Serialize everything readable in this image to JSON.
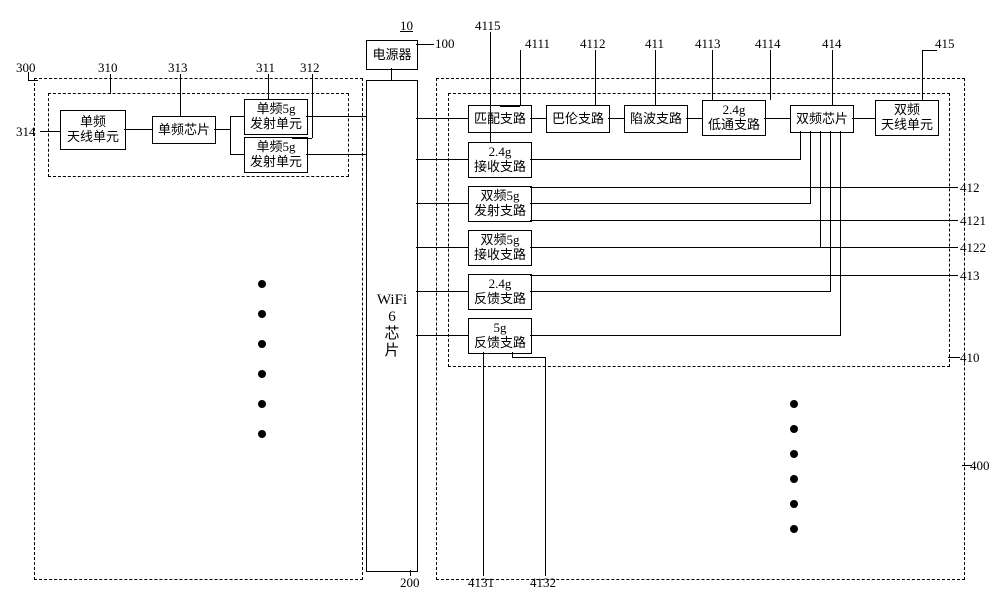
{
  "refs": {
    "r10": "10",
    "r100": "100",
    "r200": "200",
    "r300": "300",
    "r310": "310",
    "r311": "311",
    "r312": "312",
    "r313": "313",
    "r314": "314",
    "r400": "400",
    "r410": "410",
    "r411": "411",
    "r412": "412",
    "r413": "413",
    "r414": "414",
    "r415": "415",
    "r4111": "4111",
    "r4112": "4112",
    "r4113": "4113",
    "r4114": "4114",
    "r4115": "4115",
    "r4121": "4121",
    "r4122": "4122",
    "r4131": "4131",
    "r4132": "4132"
  },
  "blocks": {
    "power": "电源器",
    "wifi6": "WiFi\n6\n芯\n片",
    "sf_ant": "单频\n天线单元",
    "sf_chip": "单频芯片",
    "sf_tx1": "单频5g\n发射单元",
    "sf_tx2": "单频5g\n发射单元",
    "match": "匹配支路",
    "balun": "巴伦支路",
    "notch": "陷波支路",
    "lp24": "2.4g\n低通支路",
    "df_chip": "双频芯片",
    "df_ant": "双频\n天线单元",
    "rx24": "2.4g\n接收支路",
    "df5_tx": "双频5g\n发射支路",
    "df5_rx": "双频5g\n接收支路",
    "fb24": "2.4g\n反馈支路",
    "fb5": "5g\n反馈支路"
  }
}
